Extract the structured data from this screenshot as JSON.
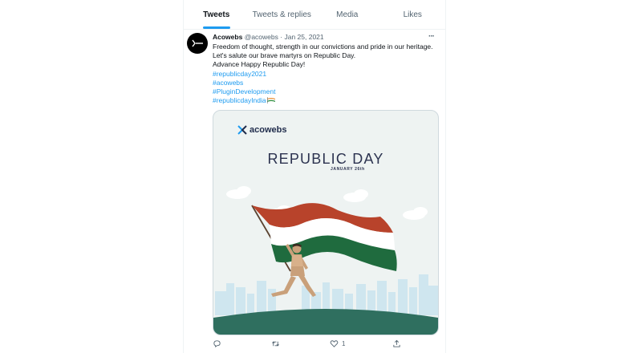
{
  "tabs": [
    {
      "label": "Tweets",
      "active": true
    },
    {
      "label": "Tweets & replies",
      "active": false
    },
    {
      "label": "Media",
      "active": false
    },
    {
      "label": "Likes",
      "active": false
    }
  ],
  "tweet": {
    "display_name": "Acowebs",
    "handle": "@acowebs",
    "separator": "·",
    "date": "Jan 25, 2021",
    "more_label": "···",
    "lines": [
      "Freedom of thought, strength in our convictions and pride in our heritage.",
      "Let's salute our brave martyrs on Republic Day.",
      "Advance Happy Republic Day!"
    ],
    "hashtags": [
      "#republicday2021",
      "#acowebs",
      "#PluginDevelopment",
      "#republicdayIndia"
    ],
    "emoji_icon": "india-flag-icon",
    "media": {
      "brand": "acowebs",
      "title": "REPUBLIC DAY",
      "subtitle": "JANUARY 26th",
      "colors": {
        "saffron": "#b8432b",
        "white": "#ffffff",
        "green": "#1f6b3e",
        "ground": "#2f6f5f",
        "sky": "#eef3f2"
      }
    },
    "actions": {
      "reply_icon": "reply-icon",
      "retweet_icon": "retweet-icon",
      "like_icon": "heart-icon",
      "like_count": "1",
      "share_icon": "share-icon"
    }
  },
  "colors": {
    "accent": "#1d9bf0",
    "text": "#0f1419",
    "muted": "#536471"
  }
}
